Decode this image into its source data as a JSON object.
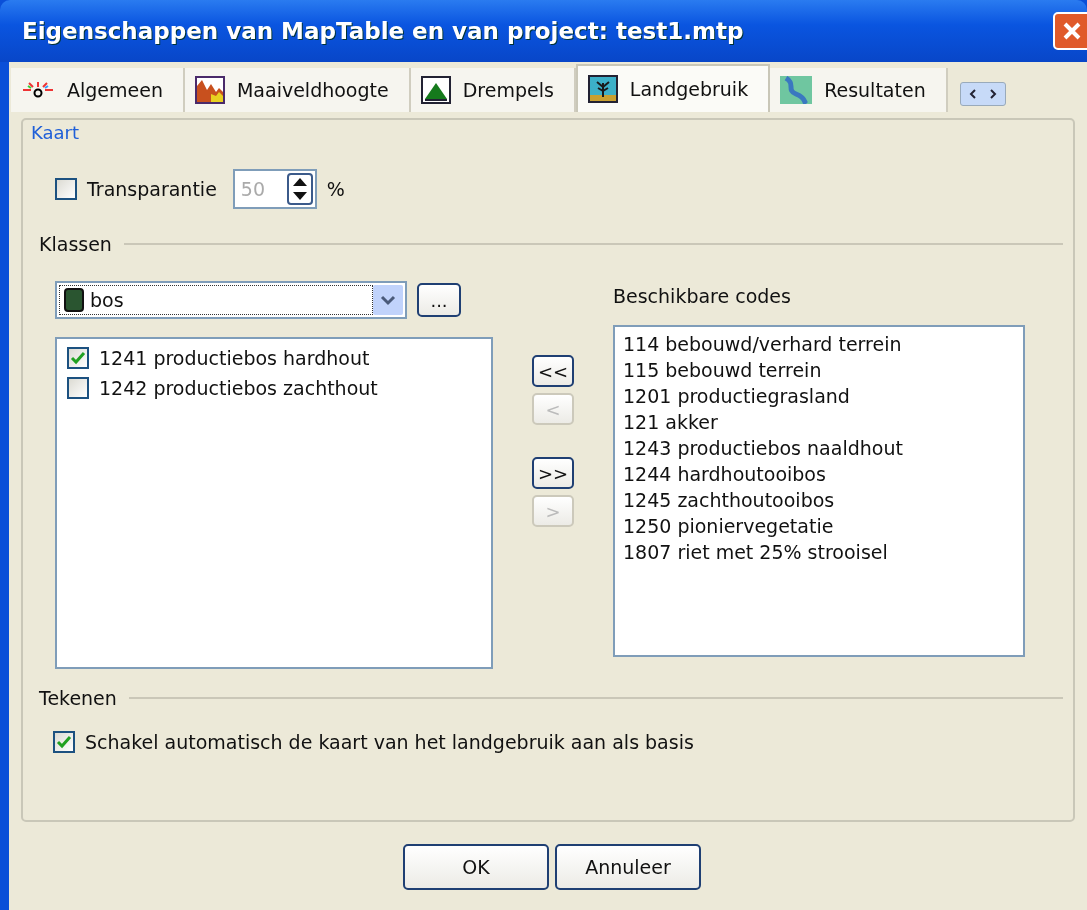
{
  "window": {
    "title": "Eigenschappen van MapTable en van project: test1.mtp"
  },
  "tabs": [
    {
      "label": "Algemeen",
      "selected": false
    },
    {
      "label": "Maaiveldhoogte",
      "selected": false
    },
    {
      "label": "Drempels",
      "selected": false
    },
    {
      "label": "Landgebruik",
      "selected": true
    },
    {
      "label": "Resultaten",
      "selected": false
    }
  ],
  "kaart": {
    "title": "Kaart",
    "transparency": {
      "label": "Transparantie",
      "checked": false,
      "value": "50",
      "disabled": true,
      "unit": "%"
    }
  },
  "klassen": {
    "title": "Klassen",
    "combo": {
      "value": "bos",
      "color": "#2a5530"
    },
    "browse_button": "...",
    "class_codes": [
      {
        "label": "1241 productiebos hardhout",
        "checked": true
      },
      {
        "label": "1242 productiebos zachthout",
        "checked": false
      }
    ],
    "move_buttons": [
      {
        "label": "<<",
        "disabled": false
      },
      {
        "label": "<",
        "disabled": true
      },
      {
        "label": ">>",
        "disabled": false
      },
      {
        "label": ">",
        "disabled": true
      }
    ],
    "available_title": "Beschikbare codes",
    "available_codes": [
      "114 bebouwd/verhard terrein",
      "115 bebouwd terrein",
      "1201 productiegrasland",
      "121 akker",
      "1243 productiebos naaldhout",
      "1244 hardhoutooibos",
      "1245 zachthoutooibos",
      "1250 pioniervegetatie",
      "1807 riet met 25% strooisel"
    ]
  },
  "tekenen": {
    "title": "Tekenen",
    "auto": {
      "label": "Schakel automatisch de kaart van het landgebruik aan als basis",
      "checked": true
    }
  },
  "buttons": [
    "OK",
    "Annuleer"
  ]
}
